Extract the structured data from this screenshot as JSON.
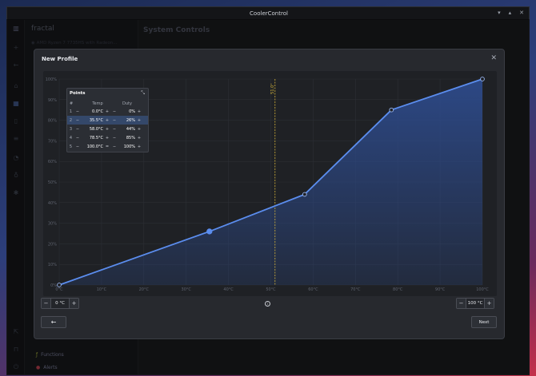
{
  "window": {
    "title": "CoolerControl"
  },
  "sidebar": {
    "brand": "fractal",
    "device": "AMD Ryzen 7 7735HS with Radeon...",
    "functions_label": "Functions",
    "alerts_label": "Alerts"
  },
  "main": {
    "title": "System Controls"
  },
  "modal": {
    "title": "New Profile",
    "close_icon": "close-icon",
    "next_label": "Next",
    "back_icon": "arrow-left-icon",
    "min_temp": "0 °C",
    "max_temp": "100 °C",
    "points_panel": {
      "title": "Points",
      "headers": {
        "num": "#",
        "temp": "Temp",
        "duty": "Duty"
      },
      "rows": [
        {
          "num": "1",
          "temp": "0.0°C",
          "duty": "0%"
        },
        {
          "num": "2",
          "temp": "35.5°C",
          "duty": "26%"
        },
        {
          "num": "3",
          "temp": "58.0°C",
          "duty": "44%"
        },
        {
          "num": "4",
          "temp": "78.5°C",
          "duty": "85%"
        },
        {
          "num": "5",
          "temp": "100.0°C",
          "duty": "100%"
        }
      ]
    }
  },
  "chart_data": {
    "type": "line",
    "x": [
      0,
      35.5,
      58.0,
      78.5,
      100.0
    ],
    "values": [
      0,
      26,
      44,
      85,
      100
    ],
    "xlim": [
      0,
      100
    ],
    "ylim": [
      0,
      100
    ],
    "x_ticks": [
      "0°C",
      "10°C",
      "20°C",
      "30°C",
      "40°C",
      "50°C",
      "60°C",
      "70°C",
      "80°C",
      "90°C",
      "100°C"
    ],
    "y_ticks": [
      "0%",
      "10%",
      "20%",
      "30%",
      "40%",
      "50%",
      "60%",
      "70%",
      "80%",
      "90%",
      "100%"
    ],
    "marker_line": {
      "x": 51,
      "label": "51.0°"
    },
    "selected_point_index": 1,
    "grid": true,
    "colors": {
      "line": "#5b8dee",
      "fill": "#2d4a8a",
      "marker_line": "#d4b43a"
    }
  }
}
